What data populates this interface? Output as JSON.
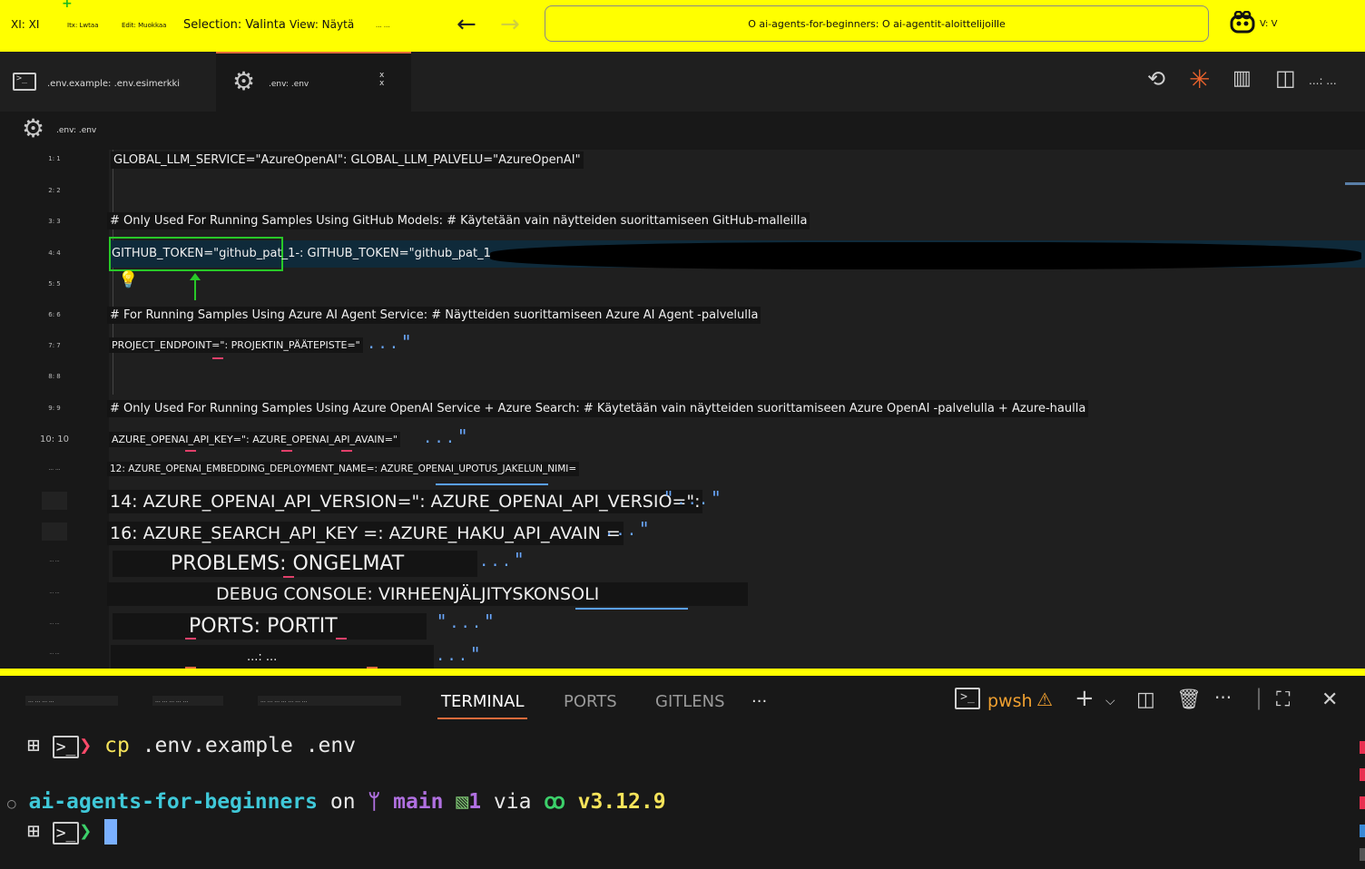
{
  "titlebar": {
    "menu_file": "XI: XI",
    "menu_tiny1": "Itx: Lwtaa",
    "menu_tiny2": "Edit: Muokkaa",
    "menu_selection": "Selection: Valinta",
    "menu_view": "View: Näytä",
    "menu_tiny3": "... ...",
    "search_text": "O ai-agents-for-beginners: O ai-agentit-aloittelijoille",
    "account_label": "V: V",
    "accent": "#ffff00"
  },
  "tabs": [
    {
      "label": ".env.example: .env.esimerkki",
      "icon": "terminal-icon"
    },
    {
      "label": ".env: .env",
      "icon": "gear-icon",
      "close": "x\nx"
    }
  ],
  "editor_actions_more": "...: ...",
  "breadcrumb": {
    "label": ".env: .env"
  },
  "gutter": [
    "1: 1",
    "2: 2",
    "3: 3",
    "4: 4",
    "5: 5",
    "6: 6",
    "7: 7",
    "8: 8",
    "9: 9",
    "10: 10",
    "... ...",
    "",
    "",
    "... ...",
    "... ...",
    "... ...",
    "... ..."
  ],
  "code": {
    "l1": "GLOBAL_LLM_SERVICE=\"AzureOpenAI\": GLOBAL_LLM_PALVELU=\"AzureOpenAI\"",
    "l3": "# Only Used For Running Samples Using GitHub Models: # Käytetään vain näytteiden suorittamiseen GitHub-malleilla",
    "l4": "GITHUB_TOKEN=\"github_pat_1-: GITHUB_TOKEN=\"github_pat_1-",
    "l6": "# For Running Samples Using Azure AI Agent Service: # Näytteiden suorittamiseen Azure AI Agent -palvelulla",
    "l7": "PROJECT_ENDPOINT=\": PROJEKTIN_PÄÄTEPISTE=\"",
    "l9": "# Only Used For Running Samples Using Azure OpenAI Service + Azure Search: # Käytetään vain näytteiden suorittamiseen Azure OpenAI -palvelulla + Azure-haulla",
    "l10": "AZURE_OPENAI_API_KEY=\": AZURE_OPENAI_API_AVAIN=\"",
    "l12": "12: AZURE_OPENAI_EMBEDDING_DEPLOYMENT_NAME=: AZURE_OPENAI_UPOTUS_JAKELUN_NIMI=",
    "l14": "14: AZURE_OPENAI_API_VERSION=\": AZURE_OPENAI_API_VERSIO=\":",
    "l16": "16: AZURE_SEARCH_API_KEY =: AZURE_HAKU_API_AVAIN =",
    "l_problems": "PROBLEMS: ONGELMAT",
    "l_debug": "DEBUG CONSOLE: VIRHEENJÄLJITYSKONSOLI",
    "l_ports": "PORTS: PORTIT",
    "l_last": "...: ...",
    "ellipsis": "...\"",
    "ellipsis_q": "\"...\"",
    "ellipsis_plain": "..."
  },
  "panel": {
    "tiny_tabs": [
      "... ... ... ...",
      "... ... ... ... ...",
      "... ... ... ... ... ... ..."
    ],
    "tabs": [
      "TERMINAL",
      "PORTS",
      "GITLENS"
    ],
    "more": "···",
    "shell": "pwsh"
  },
  "terminal": {
    "cmd": "cp",
    "cmd_args": ".env.example .env",
    "repo": "ai-agents-for-beginners",
    "on": "on",
    "branch": "main",
    "status": "1",
    "via": "via",
    "python_version": "v3.12.9",
    "prompt_char": "❯"
  }
}
